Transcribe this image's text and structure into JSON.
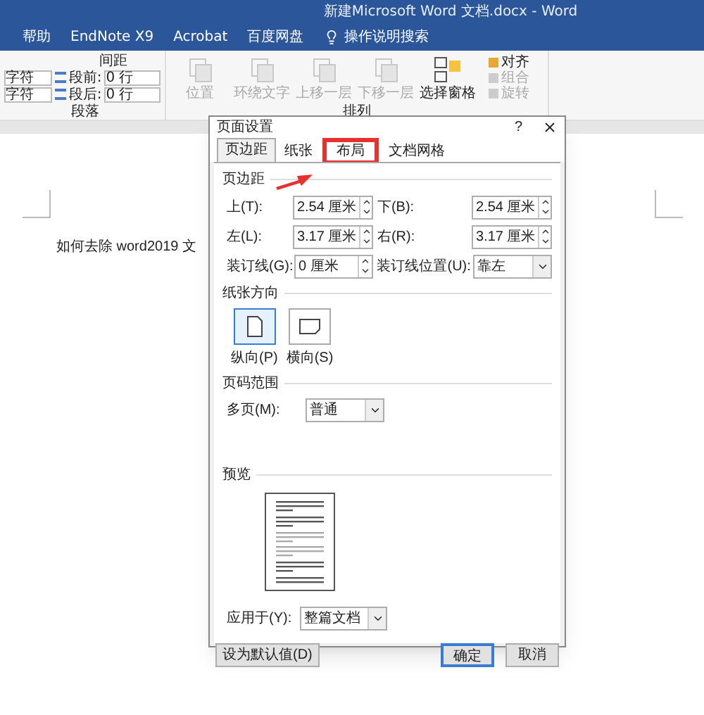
{
  "window": {
    "title": "新建Microsoft Word 文档.docx  -  Word"
  },
  "menu_tabs": [
    "帮助",
    "EndNote X9",
    "Acrobat",
    "百度网盘"
  ],
  "tell_me": "操作说明搜索",
  "ribbon": {
    "paragraph": {
      "heading": "间距",
      "label": "段落",
      "rows": [
        {
          "indent_value": "字符",
          "spacing_label": "段前:",
          "spacing_value": "0 行"
        },
        {
          "indent_value": "字符",
          "spacing_label": "段后:",
          "spacing_value": "0 行"
        }
      ]
    },
    "arrange": {
      "label": "排列",
      "large_buttons": [
        {
          "label": "位置",
          "disabled": true
        },
        {
          "label": "环绕文字",
          "disabled": true
        },
        {
          "label": "上移一层",
          "disabled": true
        },
        {
          "label": "下移一层",
          "disabled": true
        },
        {
          "label": "选择窗格",
          "disabled": false
        }
      ],
      "small_buttons": [
        {
          "label": "对齐",
          "disabled": false
        },
        {
          "label": "组合",
          "disabled": true
        },
        {
          "label": "旋转",
          "disabled": true
        }
      ]
    }
  },
  "document": {
    "text": "如何去除 word2019 文"
  },
  "dialog": {
    "title": "页面设置",
    "help": "?",
    "tabs": [
      {
        "label": "页边距",
        "selected": true,
        "highlighted": false
      },
      {
        "label": "纸张",
        "selected": false,
        "highlighted": false
      },
      {
        "label": "布局",
        "selected": false,
        "highlighted": true
      },
      {
        "label": "文档网格",
        "selected": false,
        "highlighted": false
      }
    ],
    "margins": {
      "heading": "页边距",
      "fields": [
        {
          "label": "上(T):",
          "value": "2.54 厘米",
          "kind": "spin"
        },
        {
          "label": "下(B):",
          "value": "2.54 厘米",
          "kind": "spin"
        },
        {
          "label": "左(L):",
          "value": "3.17 厘米",
          "kind": "spin"
        },
        {
          "label": "右(R):",
          "value": "3.17 厘米",
          "kind": "spin"
        },
        {
          "label": "装订线(G):",
          "value": "0 厘米",
          "kind": "spin"
        },
        {
          "label": "装订线位置(U):",
          "value": "靠左",
          "kind": "dropdown"
        }
      ]
    },
    "orientation": {
      "heading": "纸张方向",
      "options": [
        {
          "label": "纵向(P)",
          "kind": "portrait",
          "selected": true
        },
        {
          "label": "横向(S)",
          "kind": "landscape",
          "selected": false
        }
      ]
    },
    "pages": {
      "heading": "页码范围",
      "label": "多页(M):",
      "value": "普通"
    },
    "preview": {
      "heading": "预览"
    },
    "apply_to": {
      "label": "应用于(Y):",
      "value": "整篇文档"
    },
    "buttons": [
      {
        "label": "设为默认值(D)",
        "kind": "secondary"
      },
      {
        "label": "确定",
        "kind": "default"
      },
      {
        "label": "取消",
        "kind": "cancel"
      }
    ]
  }
}
